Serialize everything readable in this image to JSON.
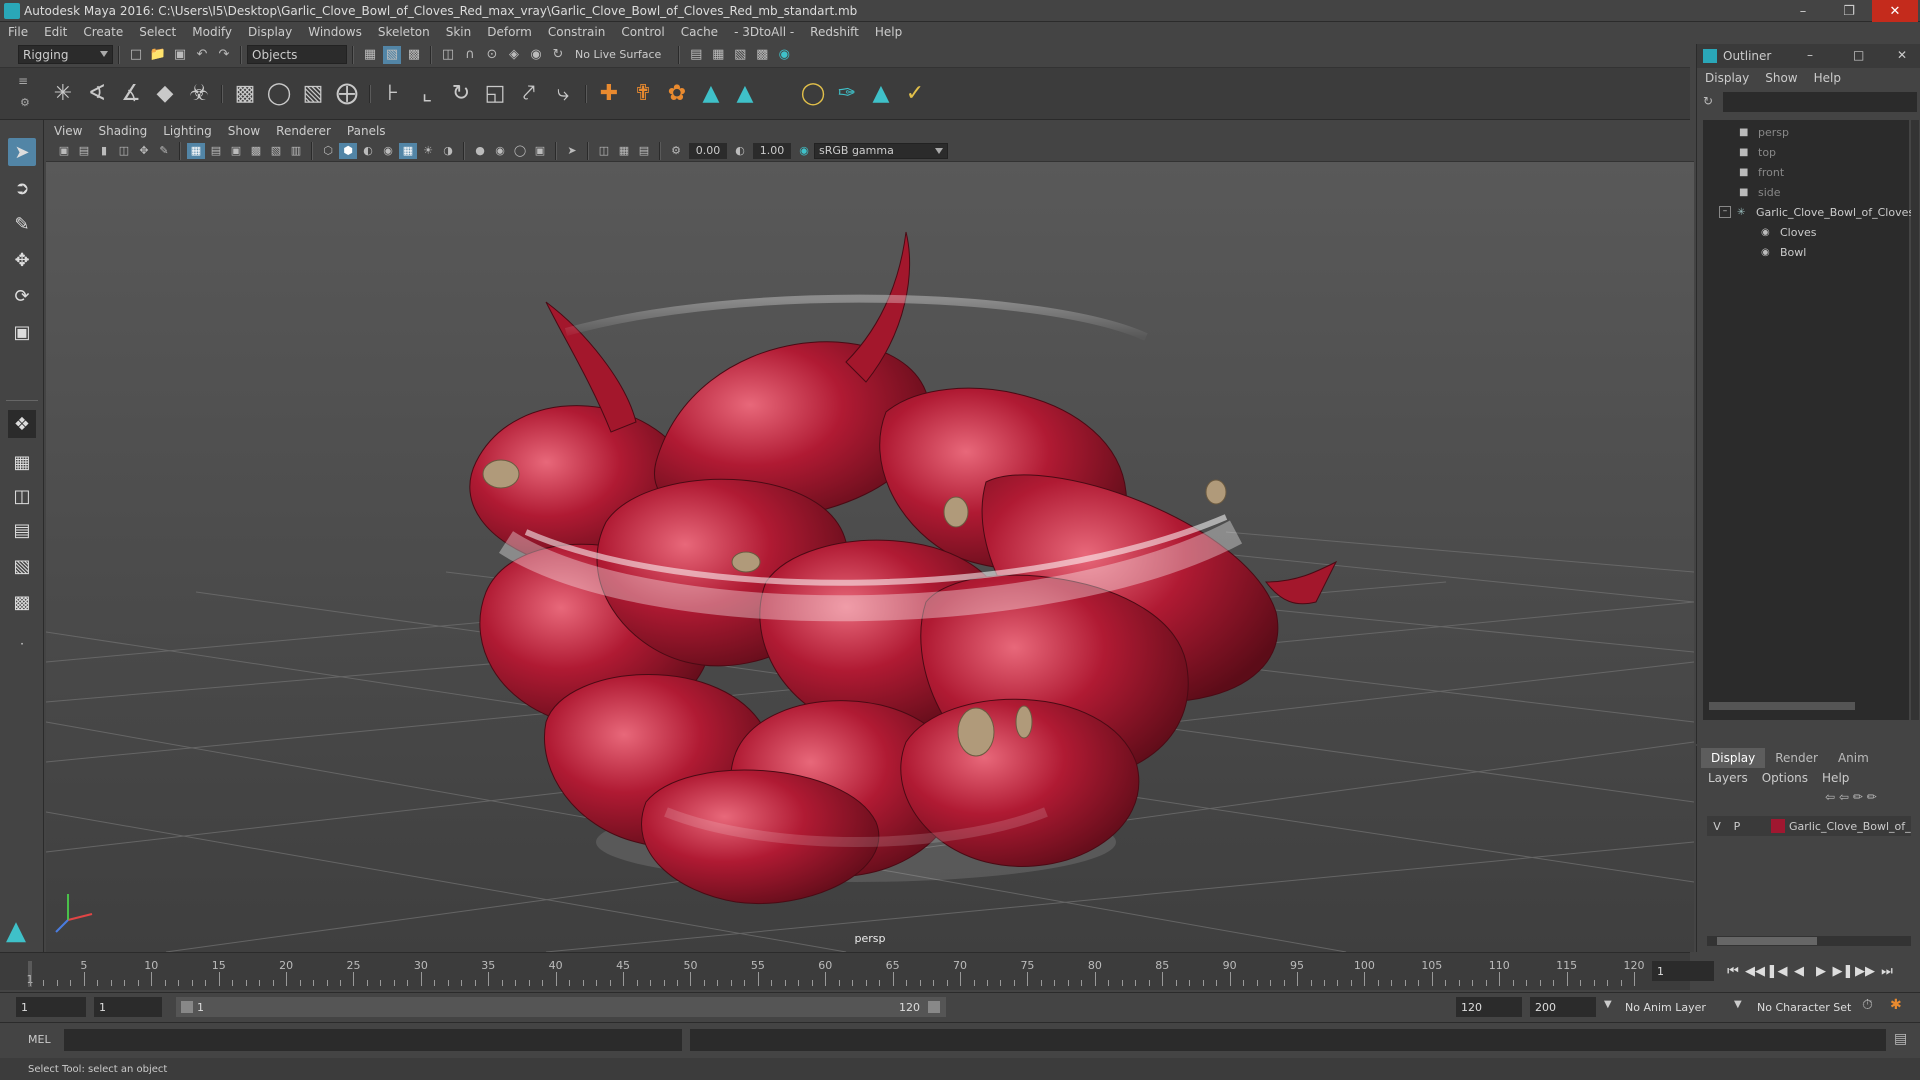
{
  "window": {
    "title": "Autodesk Maya 2016: C:\\Users\\I5\\Desktop\\Garlic_Clove_Bowl_of_Cloves_Red_max_vray\\Garlic_Clove_Bowl_of_Cloves_Red_mb_standart.mb"
  },
  "menubar": [
    "File",
    "Edit",
    "Create",
    "Select",
    "Modify",
    "Display",
    "Windows",
    "Skeleton",
    "Skin",
    "Deform",
    "Constrain",
    "Control",
    "Cache",
    "- 3DtoAll -",
    "Redshift",
    "Help"
  ],
  "statusline": {
    "mode": "Rigging",
    "selection_mode": "Objects",
    "live_surface": "No Live Surface"
  },
  "viewport": {
    "menu": [
      "View",
      "Shading",
      "Lighting",
      "Show",
      "Renderer",
      "Panels"
    ],
    "near_value": "0.00",
    "far_value": "1.00",
    "color_space": "sRGB gamma",
    "camera_label": "persp"
  },
  "outliner": {
    "title": "Outliner",
    "menu": [
      "Display",
      "Show",
      "Help"
    ],
    "items": [
      {
        "label": "persp",
        "dim": true
      },
      {
        "label": "top",
        "dim": true
      },
      {
        "label": "front",
        "dim": true
      },
      {
        "label": "side",
        "dim": true
      },
      {
        "label": "Garlic_Clove_Bowl_of_Cloves",
        "dim": false
      },
      {
        "label": "Cloves",
        "dim": false
      },
      {
        "label": "Bowl",
        "dim": false
      }
    ]
  },
  "layers": {
    "tabs": [
      "Display",
      "Render",
      "Anim"
    ],
    "menu": [
      "Layers",
      "Options",
      "Help"
    ],
    "row": {
      "visible": "V",
      "playback": "P",
      "name": "Garlic_Clove_Bowl_of_",
      "color": "#a01730"
    }
  },
  "timeline": {
    "ticks": [
      "5",
      "10",
      "15",
      "20",
      "25",
      "30",
      "35",
      "40",
      "45",
      "50",
      "55",
      "60",
      "65",
      "70",
      "75",
      "80",
      "85",
      "90",
      "95",
      "100",
      "105",
      "110",
      "115",
      "120"
    ],
    "start": "1",
    "current_frame": "1"
  },
  "range": {
    "start": "1",
    "playback_start": "1",
    "slider_start": "1",
    "slider_end": "120",
    "playback_end": "120",
    "end": "200",
    "anim_layer": "No Anim Layer",
    "character_set": "No Character Set"
  },
  "command": {
    "label": "MEL"
  },
  "help_line": "Select Tool: select an object",
  "colors": {
    "clove_red": "#b01a33",
    "accent_blue": "#5285a6"
  }
}
